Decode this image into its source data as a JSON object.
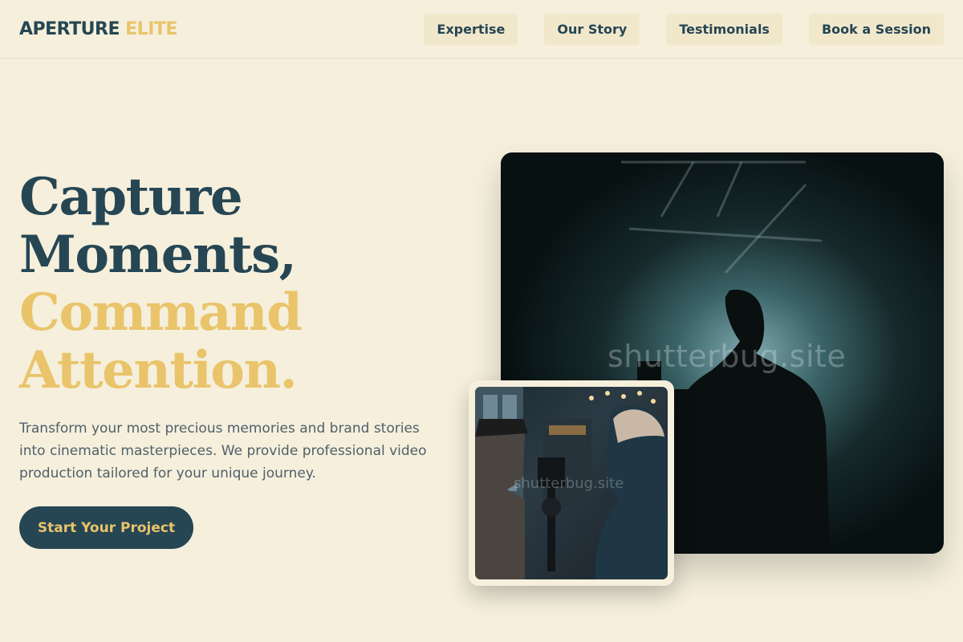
{
  "header": {
    "logo_main": "APERTURE",
    "logo_accent": "ELITE",
    "nav": [
      "Expertise",
      "Our Story",
      "Testimonials",
      "Book a Session"
    ]
  },
  "hero": {
    "title_line1": "Capture",
    "title_line2": "Moments,",
    "title_line3": "Command",
    "title_line4": "Attention.",
    "description": "Transform your most precious memories and brand stories into cinematic masterpieces. We provide professional video production tailored for your unique journey.",
    "cta_label": "Start Your Project"
  },
  "media": {
    "main_watermark": "shutterbug.site",
    "inset_watermark": "shutterbug.site"
  },
  "colors": {
    "background": "#f5efdc",
    "primary": "#264653",
    "accent": "#e9c46a",
    "nav_bg": "#f1e8cc"
  }
}
